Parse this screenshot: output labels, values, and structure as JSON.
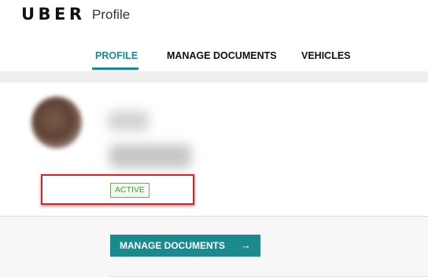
{
  "header": {
    "logo": "UBER",
    "page_name": "Profile"
  },
  "tabs": [
    {
      "label": "PROFILE",
      "active": true
    },
    {
      "label": "MANAGE DOCUMENTS",
      "active": false
    },
    {
      "label": "VEHICLES",
      "active": false
    }
  ],
  "profile": {
    "status": "ACTIVE"
  },
  "actions": {
    "manage_documents_label": "MANAGE DOCUMENTS",
    "arrow_icon": "→"
  },
  "colors": {
    "accent": "#1a8a8f",
    "status_green": "#4b9a3e",
    "highlight_red": "#e01f1f"
  }
}
